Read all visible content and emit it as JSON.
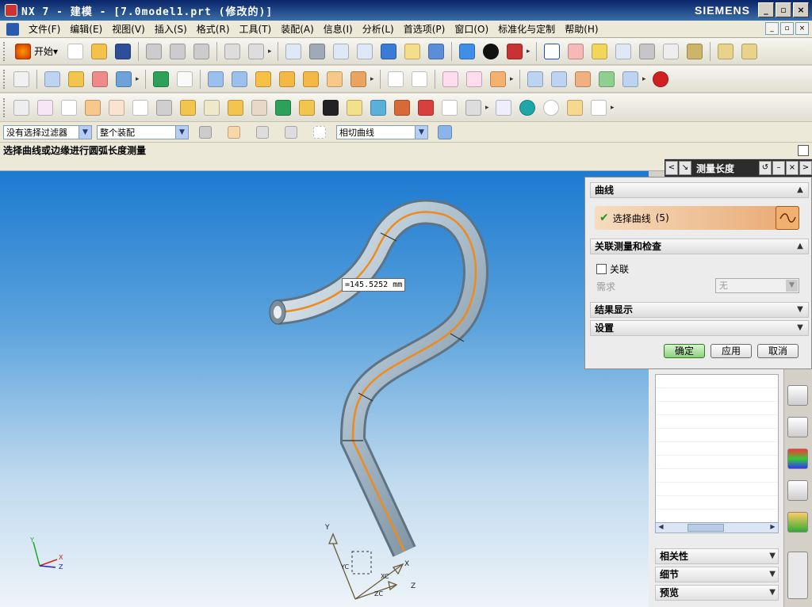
{
  "window": {
    "title": "NX 7 - 建模 - [7.0model1.prt (修改的)]",
    "brand": "SIEMENS",
    "controls": [
      "_",
      "▫",
      "×"
    ]
  },
  "menubar": {
    "items": [
      "文件(F)",
      "编辑(E)",
      "视图(V)",
      "插入(S)",
      "格式(R)",
      "工具(T)",
      "装配(A)",
      "信息(I)",
      "分析(L)",
      "首选项(P)",
      "窗口(O)",
      "标准化与定制",
      "帮助(H)"
    ]
  },
  "toolbar": {
    "start_label": "开始",
    "start_arrow": "▾"
  },
  "filterbar": {
    "type_filter": "没有选择过滤器",
    "scope": "整个装配",
    "curve_rule": "相切曲线"
  },
  "cue_line": "选择曲线或边缘进行圆弧长度测量",
  "graphics": {
    "measurement": "=145.5252 mm",
    "wcs_labels": {
      "x": "X",
      "y": "Y",
      "z": "Z"
    },
    "csys_labels": {
      "x": "X",
      "y": "Y",
      "z": "Z",
      "xc": "XC",
      "yc": "YC",
      "zc": "ZC"
    }
  },
  "dialog": {
    "title": "测量长度",
    "group_curve": "曲线",
    "select_curve_label": "选择曲线",
    "select_curve_count": "(5)",
    "group_assoc": "关联测量和检查",
    "assoc_label": "关联",
    "require_label": "需求",
    "require_value": "无",
    "group_results": "结果显示",
    "group_settings": "设置",
    "ok": "确定",
    "apply": "应用",
    "cancel": "取消"
  },
  "part_navigator": {
    "rows": [
      "相关性",
      "细节",
      "预览"
    ]
  },
  "colors": {
    "title_bar": "#0a246a",
    "graphics_top": "#1d7ad0",
    "graphics_bottom": "#eef4f9",
    "pipe": "#9fb4c2",
    "pipe_centerline": "#f08a1a",
    "selection_accent": "#e8a870"
  }
}
